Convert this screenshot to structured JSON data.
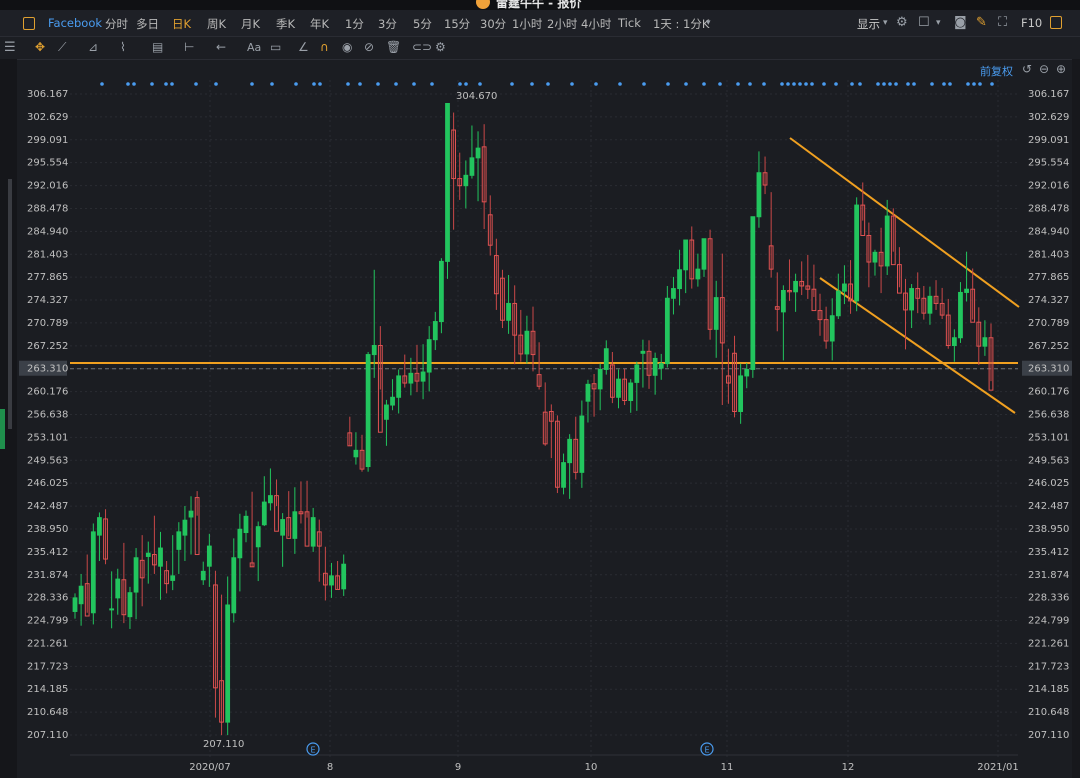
{
  "window": {
    "title": "雷霆牛牛 - 报价"
  },
  "toolbar": {
    "symbol": "Facebook",
    "timeframes": [
      {
        "label": "分时",
        "active": false
      },
      {
        "label": "多日",
        "active": false
      },
      {
        "label": "日K",
        "active": true
      },
      {
        "label": "周K",
        "active": false
      },
      {
        "label": "月K",
        "active": false
      },
      {
        "label": "季K",
        "active": false
      },
      {
        "label": "年K",
        "active": false
      },
      {
        "label": "1分",
        "active": false
      },
      {
        "label": "3分",
        "active": false
      },
      {
        "label": "5分",
        "active": false
      },
      {
        "label": "15分",
        "active": false
      },
      {
        "label": "30分",
        "active": false
      },
      {
        "label": "1小时",
        "active": false
      },
      {
        "label": "2小时",
        "active": false
      },
      {
        "label": "4小时",
        "active": false
      },
      {
        "label": "Tick",
        "active": false
      },
      {
        "label": "1天 : 1分K",
        "active": false
      }
    ],
    "display_label": "显示",
    "f10_label": "F10"
  },
  "chart": {
    "adjust_label": "前复权",
    "current_price": "263.310",
    "y_ticks": [
      "306.167",
      "302.629",
      "299.091",
      "295.554",
      "292.016",
      "288.478",
      "284.940",
      "281.403",
      "277.865",
      "274.327",
      "270.789",
      "267.252",
      "263.310",
      "260.176",
      "256.638",
      "253.101",
      "249.563",
      "246.025",
      "242.487",
      "238.950",
      "235.412",
      "231.874",
      "228.336",
      "224.799",
      "221.261",
      "217.723",
      "214.185",
      "210.648",
      "207.110"
    ],
    "x_ticks": [
      "2020/07",
      "8",
      "9",
      "10",
      "11",
      "12",
      "2021/01"
    ],
    "high_annotation": "304.670",
    "low_annotation": "207.110",
    "event_markers": [
      "E",
      "E"
    ]
  },
  "chart_data": {
    "type": "candlestick",
    "ylim": [
      207.11,
      306.167
    ],
    "candles": [
      [
        226.2,
        229.0,
        225.1,
        228.3
      ],
      [
        227.4,
        232.0,
        224.0,
        230.1
      ],
      [
        230.5,
        235.0,
        226.0,
        225.5
      ],
      [
        226.0,
        239.8,
        224.2,
        238.5
      ],
      [
        238.0,
        241.5,
        234.0,
        240.7
      ],
      [
        240.5,
        242.0,
        233.5,
        234.3
      ],
      [
        226.6,
        232.4,
        223.6,
        226.6
      ],
      [
        228.3,
        232.8,
        225.7,
        231.2
      ],
      [
        231.1,
        236.8,
        224.4,
        225.7
      ],
      [
        225.4,
        230.0,
        223.5,
        229.1
      ],
      [
        229.2,
        236.0,
        225.0,
        234.5
      ],
      [
        234.1,
        238.0,
        227.0,
        231.4
      ],
      [
        234.7,
        237.0,
        230.5,
        235.2
      ],
      [
        235.0,
        241.0,
        232.0,
        233.4
      ],
      [
        233.2,
        238.5,
        228.0,
        236.0
      ],
      [
        232.5,
        234.0,
        229.0,
        230.5
      ],
      [
        231.0,
        238.0,
        229.5,
        231.7
      ],
      [
        235.8,
        240.0,
        232.0,
        238.5
      ],
      [
        238.0,
        242.5,
        234.0,
        240.3
      ],
      [
        240.8,
        244.0,
        235.0,
        241.7
      ],
      [
        243.8,
        244.8,
        241.0,
        235.0
      ],
      [
        231.1,
        233.9,
        230.3,
        232.4
      ],
      [
        233.2,
        238.2,
        230.0,
        236.3
      ],
      [
        230.3,
        232.5,
        209.8,
        214.4
      ],
      [
        215.5,
        228.8,
        207.1,
        209.1
      ],
      [
        209.1,
        231.6,
        207.1,
        227.2
      ],
      [
        226.0,
        237.5,
        224.5,
        234.5
      ],
      [
        234.5,
        241.3,
        229.3,
        238.9
      ],
      [
        238.4,
        241.8,
        236.9,
        240.9
      ],
      [
        233.7,
        244.7,
        233.1,
        233.1
      ],
      [
        236.2,
        240.1,
        230.9,
        239.3
      ],
      [
        239.6,
        247.1,
        239.4,
        243.1
      ],
      [
        243.0,
        248.3,
        241.8,
        244.1
      ],
      [
        244.1,
        246.6,
        242.5,
        238.6
      ],
      [
        238.0,
        241.4,
        233.1,
        240.4
      ],
      [
        240.7,
        244.8,
        237.8,
        237.5
      ],
      [
        237.5,
        245.4,
        235.1,
        241.6
      ],
      [
        241.6,
        246.3,
        239.8,
        241.3
      ],
      [
        241.6,
        246.4,
        240.7,
        236.3
      ],
      [
        236.3,
        242.2,
        235.4,
        240.7
      ],
      [
        238.5,
        240.4,
        230.8,
        236.3
      ],
      [
        232.1,
        236.2,
        227.9,
        230.3
      ],
      [
        230.3,
        233.7,
        228.3,
        231.7
      ],
      [
        231.7,
        234.0,
        229.6,
        229.6
      ],
      [
        229.7,
        235.0,
        228.6,
        233.5
      ],
      [
        253.8,
        256.3,
        251.8,
        251.8
      ],
      [
        250.1,
        253.9,
        248.9,
        251.1
      ],
      [
        251.1,
        253.5,
        247.8,
        248.2
      ],
      [
        248.6,
        266.3,
        247.8,
        265.9
      ],
      [
        265.9,
        279.0,
        262.3,
        267.3
      ],
      [
        267.3,
        270.3,
        260.5,
        253.9
      ],
      [
        255.9,
        258.9,
        251.8,
        258.1
      ],
      [
        258.1,
        262.1,
        257.3,
        259.3
      ],
      [
        259.3,
        263.6,
        256.8,
        262.6
      ],
      [
        262.6,
        265.9,
        260.8,
        261.5
      ],
      [
        261.5,
        265.4,
        259.6,
        263.0
      ],
      [
        263.0,
        267.4,
        260.1,
        261.8
      ],
      [
        261.8,
        267.5,
        259.0,
        263.2
      ],
      [
        263.2,
        270.3,
        260.2,
        268.2
      ],
      [
        268.2,
        272.5,
        266.6,
        271.0
      ],
      [
        271.0,
        280.8,
        269.2,
        280.3
      ],
      [
        280.3,
        300.0,
        277.6,
        304.7
      ],
      [
        300.6,
        303.3,
        285.2,
        293.1
      ],
      [
        293.1,
        297.1,
        289.8,
        292.0
      ],
      [
        292.0,
        295.9,
        288.5,
        293.6
      ],
      [
        293.6,
        301.3,
        293.1,
        296.3
      ],
      [
        296.3,
        300.4,
        289.6,
        297.8
      ],
      [
        298.0,
        301.5,
        285.3,
        289.5
      ],
      [
        287.5,
        290.5,
        281.2,
        282.8
      ],
      [
        281.2,
        283.8,
        272.8,
        275.3
      ],
      [
        277.7,
        279.0,
        270.0,
        271.2
      ],
      [
        271.2,
        278.2,
        269.1,
        273.8
      ],
      [
        273.8,
        276.6,
        264.4,
        268.9
      ],
      [
        268.9,
        272.8,
        264.8,
        266.0
      ],
      [
        266.0,
        271.9,
        264.5,
        269.5
      ],
      [
        269.5,
        273.3,
        263.3,
        265.9
      ],
      [
        262.8,
        267.8,
        260.5,
        261.0
      ],
      [
        257.0,
        261.6,
        251.8,
        252.1
      ],
      [
        257.1,
        258.2,
        249.9,
        255.6
      ],
      [
        255.6,
        256.5,
        244.5,
        245.4
      ],
      [
        245.4,
        250.6,
        244.3,
        249.2
      ],
      [
        249.2,
        253.6,
        243.6,
        252.8
      ],
      [
        252.8,
        256.3,
        246.6,
        247.7
      ],
      [
        247.7,
        258.8,
        245.3,
        256.4
      ],
      [
        258.7,
        262.0,
        255.4,
        261.3
      ],
      [
        261.4,
        262.9,
        256.3,
        260.6
      ],
      [
        260.6,
        264.5,
        257.3,
        263.6
      ],
      [
        263.6,
        268.1,
        262.8,
        266.8
      ],
      [
        264.3,
        266.3,
        258.4,
        259.3
      ],
      [
        259.3,
        263.6,
        257.6,
        262.1
      ],
      [
        262.1,
        263.7,
        258.1,
        258.8
      ],
      [
        258.8,
        262.1,
        256.9,
        261.5
      ],
      [
        261.6,
        264.8,
        257.2,
        264.3
      ],
      [
        266.1,
        268.2,
        260.8,
        266.4
      ],
      [
        266.4,
        268.1,
        260.6,
        262.7
      ],
      [
        262.7,
        266.2,
        259.7,
        265.3
      ],
      [
        263.8,
        266.0,
        262.0,
        264.5
      ],
      [
        264.5,
        276.5,
        263.9,
        274.6
      ],
      [
        274.6,
        277.9,
        272.1,
        276.1
      ],
      [
        276.1,
        282.1,
        273.5,
        279.0
      ],
      [
        279.0,
        282.1,
        275.4,
        283.6
      ],
      [
        283.6,
        285.7,
        276.1,
        277.6
      ],
      [
        277.6,
        281.5,
        276.4,
        279.1
      ],
      [
        279.1,
        282.6,
        277.9,
        283.8
      ],
      [
        283.8,
        285.2,
        268.2,
        269.8
      ],
      [
        269.8,
        277.3,
        265.4,
        274.7
      ],
      [
        274.7,
        281.5,
        258.1,
        267.7
      ],
      [
        262.6,
        266.8,
        258.3,
        261.5
      ],
      [
        266.1,
        268.8,
        256.2,
        257.1
      ],
      [
        257.1,
        264.5,
        255.2,
        262.6
      ],
      [
        262.6,
        264.6,
        260.7,
        263.6
      ],
      [
        263.6,
        287.1,
        262.3,
        287.2
      ],
      [
        287.2,
        297.3,
        285.5,
        294.0
      ],
      [
        294.0,
        296.5,
        290.7,
        292.1
      ],
      [
        282.7,
        291.0,
        277.8,
        279.1
      ],
      [
        273.3,
        278.6,
        269.5,
        272.9
      ],
      [
        272.5,
        276.6,
        265.0,
        275.8
      ],
      [
        275.8,
        280.6,
        274.2,
        275.6
      ],
      [
        275.6,
        278.4,
        272.5,
        277.2
      ],
      [
        277.2,
        280.3,
        275.1,
        276.5
      ],
      [
        276.5,
        281.3,
        274.5,
        276.0
      ],
      [
        276.0,
        279.8,
        274.8,
        272.7
      ],
      [
        272.7,
        275.3,
        268.8,
        271.3
      ],
      [
        271.3,
        273.3,
        266.8,
        268.0
      ],
      [
        268.0,
        274.6,
        265.0,
        271.9
      ],
      [
        271.9,
        278.4,
        271.4,
        275.7
      ],
      [
        275.7,
        279.7,
        273.7,
        276.8
      ],
      [
        276.8,
        280.5,
        272.2,
        274.2
      ],
      [
        274.2,
        290.2,
        272.6,
        289.0
      ],
      [
        289.0,
        292.5,
        286.6,
        284.3
      ],
      [
        284.3,
        286.3,
        276.3,
        280.2
      ],
      [
        280.2,
        282.1,
        278.1,
        281.7
      ],
      [
        281.7,
        285.5,
        275.4,
        279.6
      ],
      [
        279.6,
        289.8,
        278.2,
        287.3
      ],
      [
        287.3,
        288.5,
        281.8,
        279.8
      ],
      [
        279.8,
        282.5,
        276.3,
        275.4
      ],
      [
        275.4,
        277.6,
        266.7,
        272.8
      ],
      [
        272.8,
        276.8,
        270.0,
        276.1
      ],
      [
        276.1,
        278.6,
        272.3,
        274.6
      ],
      [
        274.6,
        276.5,
        271.3,
        272.3
      ],
      [
        272.3,
        276.4,
        270.5,
        274.9
      ],
      [
        274.9,
        277.4,
        272.8,
        273.8
      ],
      [
        273.8,
        276.2,
        271.4,
        272.0
      ],
      [
        272.0,
        274.5,
        266.8,
        267.3
      ],
      [
        267.3,
        269.8,
        264.8,
        268.5
      ],
      [
        268.5,
        277.1,
        267.7,
        275.5
      ],
      [
        275.5,
        281.8,
        274.1,
        276.0
      ],
      [
        276.0,
        279.2,
        271.3,
        270.9
      ],
      [
        270.9,
        273.2,
        264.3,
        267.2
      ],
      [
        267.2,
        271.2,
        265.7,
        268.5
      ],
      [
        268.5,
        270.7,
        261.8,
        260.4
      ]
    ],
    "drawn_lines": [
      {
        "type": "horizontal",
        "price": 264.6
      },
      {
        "type": "trend",
        "from": [
          790,
          138
        ],
        "to": [
          1019,
          307
        ]
      },
      {
        "type": "trend",
        "from": [
          820,
          278
        ],
        "to": [
          1015,
          413
        ]
      }
    ]
  }
}
